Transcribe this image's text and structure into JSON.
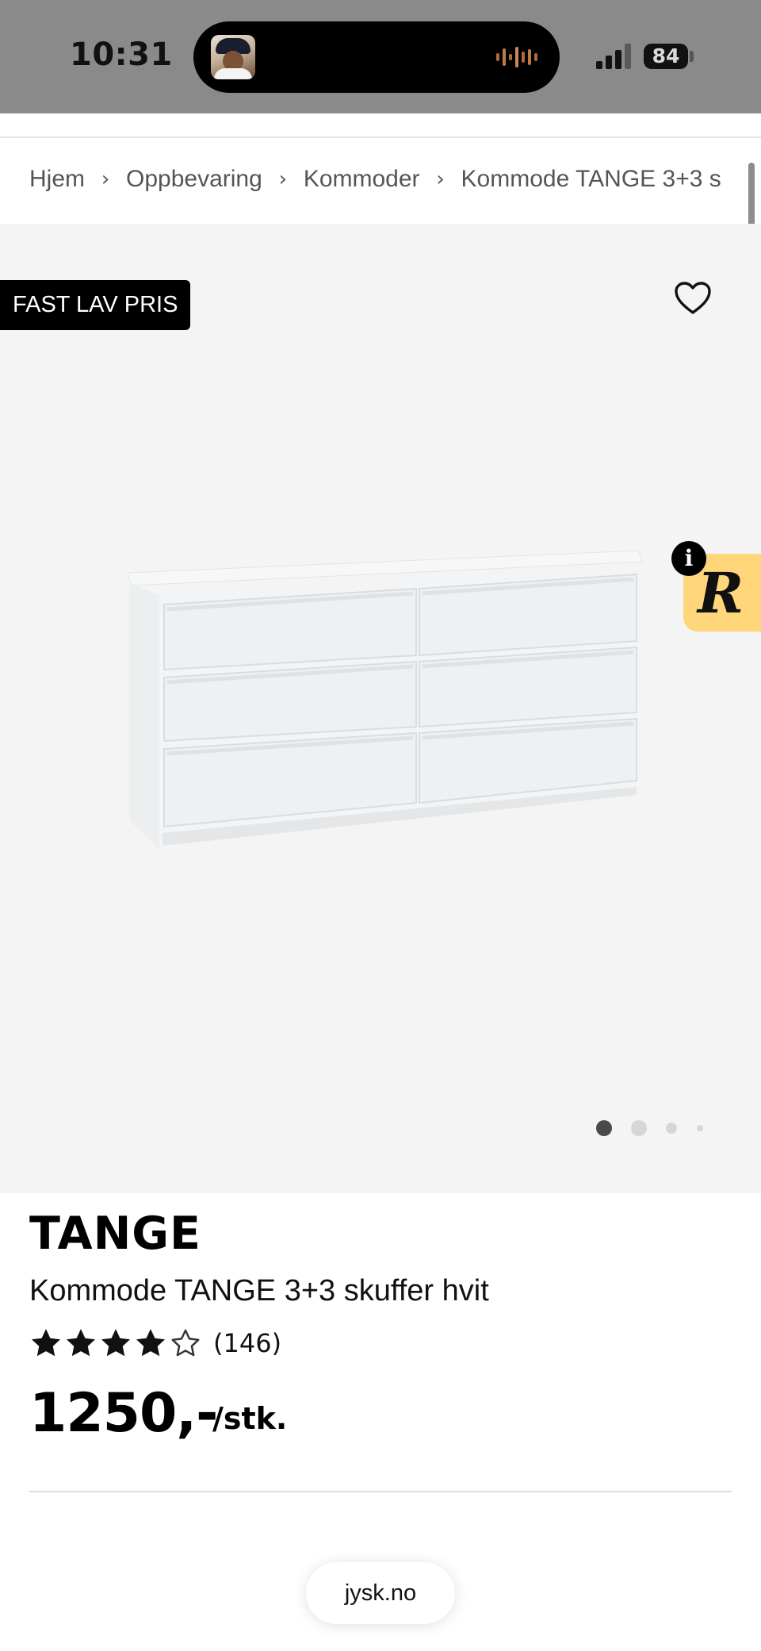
{
  "status_bar": {
    "time": "10:31",
    "battery": "84"
  },
  "breadcrumb": [
    "Hjem",
    "Oppbevaring",
    "Kommoder",
    "Kommode TANGE 3+3 s"
  ],
  "gallery": {
    "badge": "FAST LAV PRIS",
    "favorite_icon": "heart-outline-icon",
    "widget_letter": "R",
    "widget_info": "i",
    "image_count": 4,
    "active_image": 1
  },
  "product": {
    "brand": "TANGE",
    "name": "Kommode TANGE 3+3 skuffer hvit",
    "rating": {
      "value": 4,
      "max": 5,
      "reviews": "(146)"
    },
    "price": "1250,-",
    "unit": "/stk."
  },
  "browser": {
    "url": "jysk.no"
  },
  "colors": {
    "status_bar": "#8a8a8a",
    "gallery_bg": "#f4f4f4",
    "badge_bg": "#000000",
    "widget_bg": "#ffd67a"
  }
}
